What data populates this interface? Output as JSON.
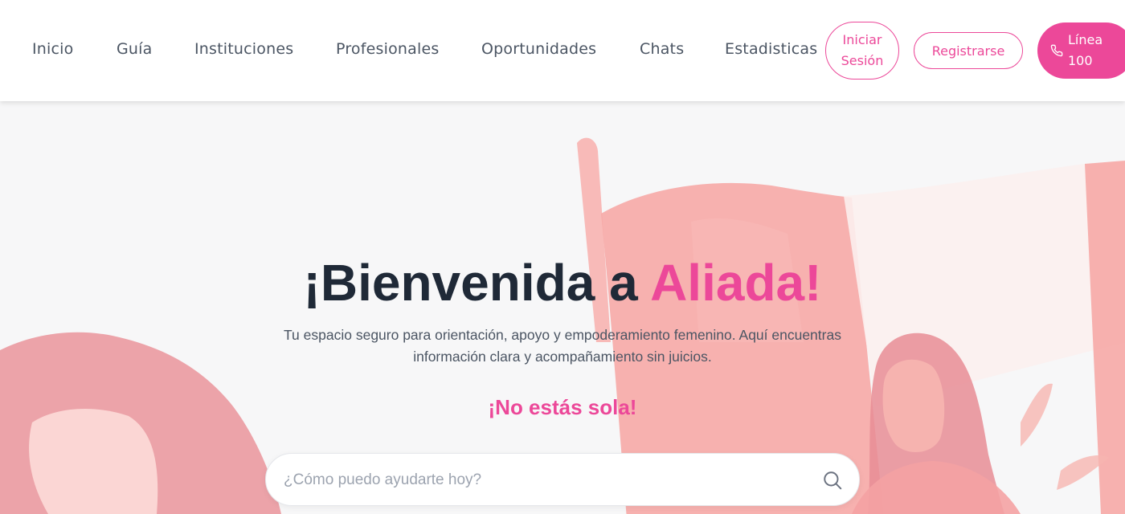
{
  "nav": {
    "links": [
      "Inicio",
      "Guía",
      "Instituciones",
      "Profesionales",
      "Oportunidades",
      "Chats",
      "Estadisticas"
    ],
    "login_line1": "Iniciar",
    "login_line2": "Sesión",
    "register": "Registrarse",
    "hotline_line1": "Línea",
    "hotline_line2": "100",
    "hotline_icon": "phone-icon"
  },
  "hero": {
    "title_part1": "¡Bienvenida a ",
    "title_accent": "Aliada!",
    "subtitle": "Tu espacio seguro para orientación, apoyo y empoderamiento femenino. Aquí encuentras información clara y acompañamiento sin juicios.",
    "tagline": "¡No estás sola!",
    "search_placeholder": "¿Cómo puedo ayudarte hoy?",
    "search_value": "",
    "search_icon": "search-icon"
  },
  "colors": {
    "accent": "#ec4899",
    "text_dark": "#1f2937",
    "text_muted": "#4b5563",
    "illustration_pink": "#f9a8a8"
  }
}
